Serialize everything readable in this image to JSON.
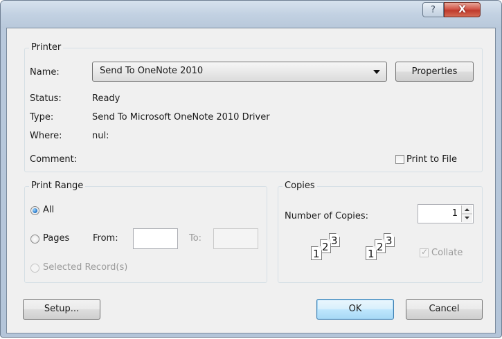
{
  "window": {
    "help_glyph": "?",
    "close_glyph": "X"
  },
  "printer": {
    "legend": "Printer",
    "name_label": "Name:",
    "name_value": "Send To OneNote 2010",
    "properties_label": "Properties",
    "status_label": "Status:",
    "status_value": "Ready",
    "type_label": "Type:",
    "type_value": "Send To Microsoft OneNote 2010 Driver",
    "where_label": "Where:",
    "where_value": "nul:",
    "comment_label": "Comment:",
    "print_to_file_label": "Print to File"
  },
  "print_range": {
    "legend": "Print Range",
    "all_label": "All",
    "pages_label": "Pages",
    "from_label": "From:",
    "to_label": "To:",
    "selected_label": "Selected Record(s)"
  },
  "copies": {
    "legend": "Copies",
    "number_label": "Number of Copies:",
    "number_value": "1",
    "collate_label": "Collate",
    "collate_pages": [
      "1",
      "2",
      "3"
    ]
  },
  "buttons": {
    "setup": "Setup...",
    "ok": "OK",
    "cancel": "Cancel"
  },
  "colors": {
    "default_button_border": "#3c7fb1",
    "close_button": "#c8473a"
  },
  "icons": {
    "help": "question-mark-icon",
    "close": "close-x-icon",
    "dropdown": "triangle-down-icon",
    "spin": "spin-arrows-icon"
  }
}
